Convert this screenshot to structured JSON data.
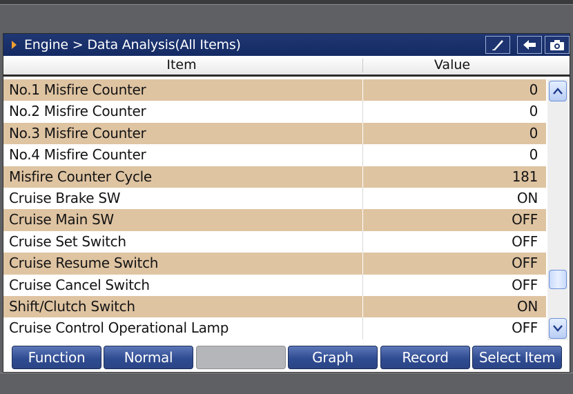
{
  "title_bar": {
    "breadcrumb": "Engine > Data Analysis(All Items)",
    "buttons": [
      "pen-icon",
      "back-arrow-icon",
      "camera-icon"
    ]
  },
  "table": {
    "headers": {
      "item": "Item",
      "value": "Value"
    },
    "rows": [
      {
        "item": "No.1 Misfire Counter",
        "value": "0"
      },
      {
        "item": "No.2 Misfire Counter",
        "value": "0"
      },
      {
        "item": "No.3 Misfire Counter",
        "value": "0"
      },
      {
        "item": "No.4 Misfire Counter",
        "value": "0"
      },
      {
        "item": "Misfire Counter Cycle",
        "value": "181"
      },
      {
        "item": "Cruise Brake SW",
        "value": "ON"
      },
      {
        "item": "Cruise Main SW",
        "value": "OFF"
      },
      {
        "item": "Cruise Set Switch",
        "value": "OFF"
      },
      {
        "item": "Cruise Resume Switch",
        "value": "OFF"
      },
      {
        "item": "Cruise Cancel Switch",
        "value": "OFF"
      },
      {
        "item": "Shift/Clutch Switch",
        "value": "ON"
      },
      {
        "item": "Cruise Control Operational Lamp",
        "value": "OFF"
      }
    ]
  },
  "footer": {
    "buttons": [
      {
        "label": "Function",
        "enabled": true
      },
      {
        "label": "Normal",
        "enabled": true
      },
      {
        "label": "",
        "enabled": false
      },
      {
        "label": "Graph",
        "enabled": true
      },
      {
        "label": "Record",
        "enabled": true
      },
      {
        "label": "Select Item",
        "enabled": true
      }
    ]
  },
  "colors": {
    "title_bar": "#1a3070",
    "accent_arrow": "#f0a030",
    "row_shaded": "#dfc4a2",
    "row_plain": "#ffffff",
    "button": "#304c92"
  }
}
